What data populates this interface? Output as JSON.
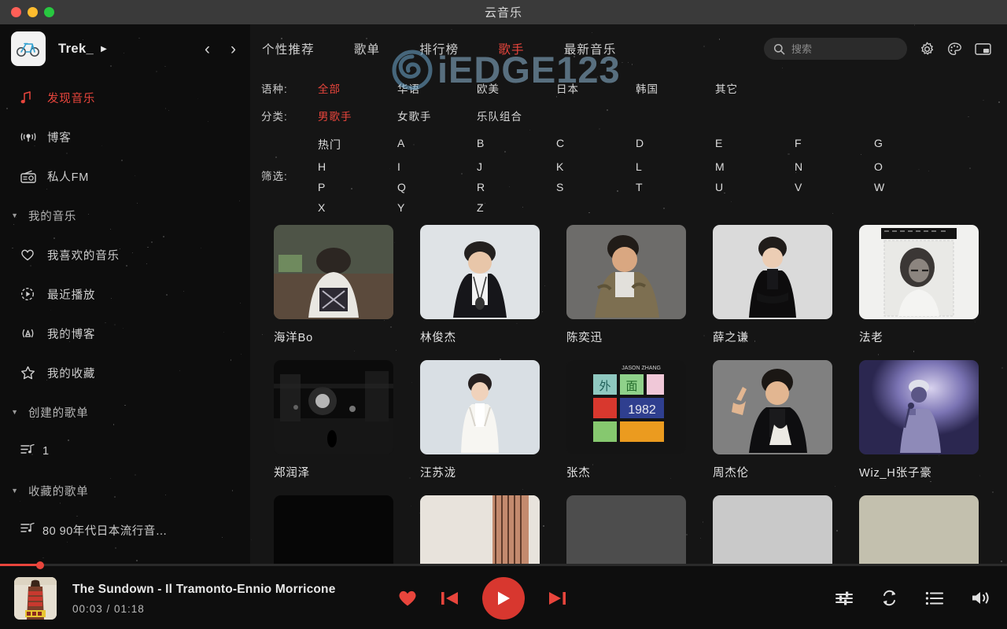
{
  "window": {
    "title": "云音乐",
    "traffic_lights": [
      "close",
      "minimize",
      "maximize"
    ]
  },
  "sidebar": {
    "user": {
      "name": "Trek_",
      "caret": "▶",
      "avatar_icon": "bicycle-icon"
    },
    "nav": {
      "back": "‹",
      "forward": "›"
    },
    "primary_items": [
      {
        "icon": "music-note-icon",
        "label": "发现音乐",
        "active": true
      },
      {
        "icon": "podcast-icon",
        "label": "博客",
        "active": false
      },
      {
        "icon": "radio-icon",
        "label": "私人FM",
        "active": false
      }
    ],
    "groups": [
      {
        "label": "我的音乐",
        "expanded": true,
        "items": [
          {
            "icon": "heart-icon",
            "label": "我喜欢的音乐"
          },
          {
            "icon": "recent-play-icon",
            "label": "最近播放"
          },
          {
            "icon": "broadcast-icon",
            "label": "我的博客"
          },
          {
            "icon": "star-icon",
            "label": "我的收藏"
          }
        ]
      },
      {
        "label": "创建的歌单",
        "expanded": true,
        "playlists": [
          {
            "icon": "playlist-icon",
            "label": "1"
          }
        ]
      },
      {
        "label": "收藏的歌单",
        "expanded": true,
        "playlists": [
          {
            "icon": "playlist-icon",
            "label": "80 90年代日本流行音…"
          }
        ]
      }
    ]
  },
  "topnav": {
    "tabs": [
      {
        "label": "个性推荐",
        "active": false
      },
      {
        "label": "歌单",
        "active": false
      },
      {
        "label": "排行榜",
        "active": false
      },
      {
        "label": "歌手",
        "active": true
      },
      {
        "label": "最新音乐",
        "active": false
      }
    ],
    "search": {
      "icon": "search-icon",
      "placeholder": "搜索",
      "value": ""
    },
    "tools": [
      {
        "icon": "gear-icon",
        "name": "settings"
      },
      {
        "icon": "palette-icon",
        "name": "theme"
      },
      {
        "icon": "mini-player-icon",
        "name": "mini-player"
      }
    ]
  },
  "filters": {
    "language": {
      "label": "语种:",
      "options": [
        "全部",
        "华语",
        "欧美",
        "日本",
        "韩国",
        "其它"
      ],
      "selected": "全部"
    },
    "category": {
      "label": "分类:",
      "options": [
        "男歌手",
        "女歌手",
        "乐队组合"
      ],
      "selected": "男歌手"
    },
    "letters": {
      "label": "筛选:",
      "options": [
        "热门",
        "A",
        "B",
        "C",
        "D",
        "E",
        "F",
        "G",
        "H",
        "I",
        "J",
        "K",
        "L",
        "M",
        "N",
        "O",
        "P",
        "Q",
        "R",
        "S",
        "T",
        "U",
        "V",
        "W",
        "X",
        "Y",
        "Z"
      ],
      "selected": "热门"
    }
  },
  "artists": [
    {
      "name": "海洋Bo",
      "thumb": "dark-field-portrait"
    },
    {
      "name": "林俊杰",
      "thumb": "light-studio-portrait"
    },
    {
      "name": "陈奕迅",
      "thumb": "grey-camo-portrait"
    },
    {
      "name": "薛之谦",
      "thumb": "black-suit-portrait"
    },
    {
      "name": "法老",
      "thumb": "bw-stamp-portrait"
    },
    {
      "name": "郑润泽",
      "thumb": "night-street-bw"
    },
    {
      "name": "汪苏泷",
      "thumb": "white-suit-portrait"
    },
    {
      "name": "张杰",
      "thumb": "album-tiles-1982"
    },
    {
      "name": "周杰伦",
      "thumb": "pointing-portrait"
    },
    {
      "name": "Wiz_H张子豪",
      "thumb": "purple-stage-photo"
    }
  ],
  "watermark": {
    "text": "iEDGE123",
    "icon": "swirl-logo-icon"
  },
  "player": {
    "now_playing": {
      "title": "The Sundown - Il Tramonto-Ennio Morricone",
      "elapsed": "00:03",
      "duration": "01:18",
      "time_display": "00:03 / 01:18",
      "progress_percent": 4,
      "cover": "western-movie-poster"
    },
    "controls": [
      {
        "icon": "heart-icon",
        "name": "like"
      },
      {
        "icon": "previous-icon",
        "name": "previous"
      },
      {
        "icon": "play-icon",
        "name": "play"
      },
      {
        "icon": "next-icon",
        "name": "next"
      }
    ],
    "right_controls": [
      {
        "icon": "equalizer-icon",
        "name": "equalizer"
      },
      {
        "icon": "repeat-icon",
        "name": "repeat-mode"
      },
      {
        "icon": "playlist-icon",
        "name": "play-queue"
      },
      {
        "icon": "volume-icon",
        "name": "volume"
      }
    ]
  },
  "colors": {
    "accent": "#e8453c",
    "play_button": "#d8372f",
    "sidebar_bg": "#0d0d0d",
    "main_bg": "#151515",
    "titlebar_bg": "#3a3a3a",
    "player_bg": "#0e0e0e"
  }
}
